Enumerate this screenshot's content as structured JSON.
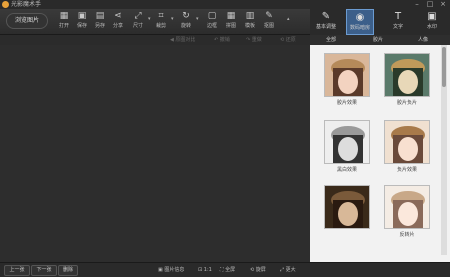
{
  "app": {
    "title": "光影魔术手"
  },
  "window": {
    "min": "–",
    "max": "□",
    "close": "×"
  },
  "toolbar": {
    "open_label": "浏览图片",
    "tools": [
      {
        "label": "打开",
        "icon": "▦"
      },
      {
        "label": "保存",
        "icon": "▣"
      },
      {
        "label": "另存",
        "icon": "▤"
      },
      {
        "label": "分享",
        "icon": "⋖"
      },
      {
        "label": "尺寸",
        "icon": "⤢"
      },
      {
        "label": "裁剪",
        "icon": "⌗"
      },
      {
        "label": "旋转",
        "icon": "↻"
      },
      {
        "label": "边框",
        "icon": "▢"
      },
      {
        "label": "拼图",
        "icon": "▦"
      },
      {
        "label": "模板",
        "icon": "▥"
      },
      {
        "label": "抠图",
        "icon": "✎"
      }
    ]
  },
  "subbar": {
    "items": [
      "◀ 原图对比",
      "↶ 撤销",
      "↷ 重做",
      "⟲ 还原"
    ]
  },
  "right_tabs": [
    {
      "label": "基本调整",
      "icon": "✎"
    },
    {
      "label": "数码暗房",
      "icon": "◉"
    },
    {
      "label": "文字",
      "icon": "T"
    },
    {
      "label": "水印",
      "icon": "▣"
    }
  ],
  "filter_tabs": [
    "全部",
    "胶片",
    "人像"
  ],
  "filters": [
    {
      "label": "胶片效果"
    },
    {
      "label": "胶片负片"
    },
    {
      "label": "黑白效果"
    },
    {
      "label": "负片效果"
    },
    {
      "label": ""
    },
    {
      "label": "反转片"
    }
  ],
  "statusbar": {
    "prev": "上一张",
    "next": "下一张",
    "delete": "删除",
    "items": [
      "▣ 图片信息",
      "⊡ 1:1",
      "⛶ 全屏",
      "⟲ 旋屏",
      "⤢ 更大"
    ]
  },
  "colors": {
    "accent": "#3c5f8a",
    "panel_bg": "#f2f2f2",
    "canvas_bg": "#2d2d2d"
  }
}
